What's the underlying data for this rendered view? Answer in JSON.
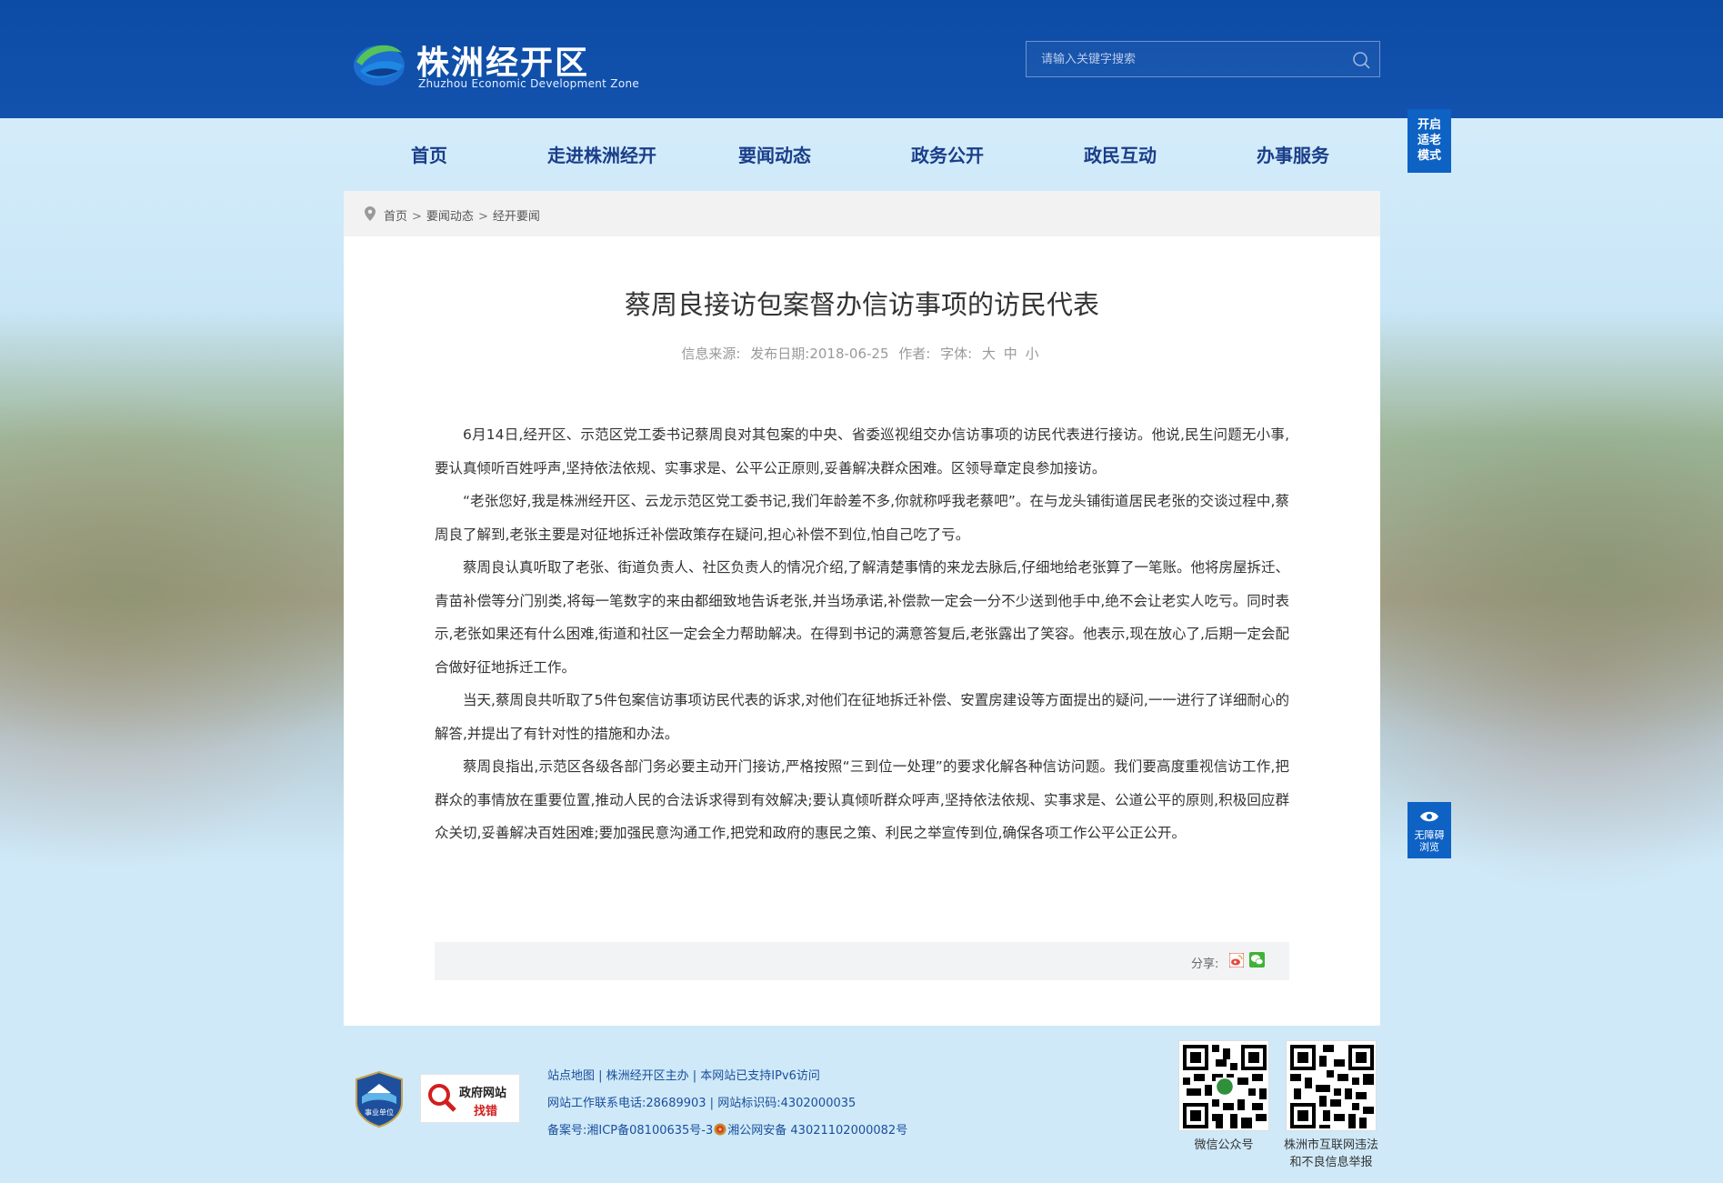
{
  "header": {
    "site_name": "株洲经开区",
    "site_name_en": "Zhuzhou Economic Development Zone",
    "search_placeholder": "请输入关键字搜索"
  },
  "nav": {
    "items": [
      "首页",
      "走进株洲经开",
      "要闻动态",
      "政务公开",
      "政民互动",
      "办事服务"
    ]
  },
  "elder_mode": [
    "开启",
    "适老",
    "模式"
  ],
  "breadcrumb": [
    "首页",
    "要闻动态",
    "经开要闻"
  ],
  "breadcrumb_sep": ">",
  "article": {
    "title": "蔡周良接访包案督办信访事项的访民代表",
    "meta_source": "信息来源:",
    "meta_date": "发布日期:2018-06-25",
    "meta_author": "作者:",
    "meta_font_label": "字体:",
    "meta_font_sizes": [
      "大",
      "中",
      "小"
    ],
    "paragraphs": [
      "6月14日,经开区、示范区党工委书记蔡周良对其包案的中央、省委巡视组交办信访事项的访民代表进行接访。他说,民生问题无小事,要认真倾听百姓呼声,坚持依法依规、实事求是、公平公正原则,妥善解决群众困难。区领导章定良参加接访。",
      "“老张您好,我是株洲经开区、云龙示范区党工委书记,我们年龄差不多,你就称呼我老蔡吧”。在与龙头铺街道居民老张的交谈过程中,蔡周良了解到,老张主要是对征地拆迁补偿政策存在疑问,担心补偿不到位,怕自己吃了亏。",
      "蔡周良认真听取了老张、街道负责人、社区负责人的情况介绍,了解清楚事情的来龙去脉后,仔细地给老张算了一笔账。他将房屋拆迁、青苗补偿等分门别类,将每一笔数字的来由都细致地告诉老张,并当场承诺,补偿款一定会一分不少送到他手中,绝不会让老实人吃亏。同时表示,老张如果还有什么困难,街道和社区一定会全力帮助解决。在得到书记的满意答复后,老张露出了笑容。他表示,现在放心了,后期一定会配合做好征地拆迁工作。",
      "当天,蔡周良共听取了5件包案信访事项访民代表的诉求,对他们在征地拆迁补偿、安置房建设等方面提出的疑问,一一进行了详细耐心的解答,并提出了有针对性的措施和办法。",
      "蔡周良指出,示范区各级各部门务必要主动开门接访,严格按照“三到位一处理”的要求化解各种信访问题。我们要高度重视信访工作,把群众的事情放在重要位置,推动人民的合法诉求得到有效解决;要认真倾听群众呼声,坚持依法依规、实事求是、公道公平的原则,积极回应群众关切,妥善解决百姓困难;要加强民意沟通工作,把党和政府的惠民之策、利民之举宣传到位,确保各项工作公平公正公开。"
    ],
    "share_label": "分享:"
  },
  "footer": {
    "badge1_text": "事业单位",
    "badge2_line1": "政府网站",
    "badge2_line2": "找错",
    "line1": "站点地图 | 株洲经开区主办 | 本网站已支持IPv6访问",
    "line2": "网站工作联系电话:28689903 | 网站标识码:4302000035",
    "line3_a": "备案号:湘ICP备08100635号-3",
    "line3_b": "湘公网安备 43021102000082号",
    "qr1_caption": "微信公众号",
    "qr2_caption_1": "株洲市互联网违法",
    "qr2_caption_2": "和不良信息举报"
  },
  "accessibility": [
    "无障碍",
    "浏览"
  ],
  "colors": {
    "header_bg": "#1252ae",
    "nav_text": "#1a3e8a",
    "side_button": "#0d62c4",
    "footer_link": "#1a4f9c"
  }
}
